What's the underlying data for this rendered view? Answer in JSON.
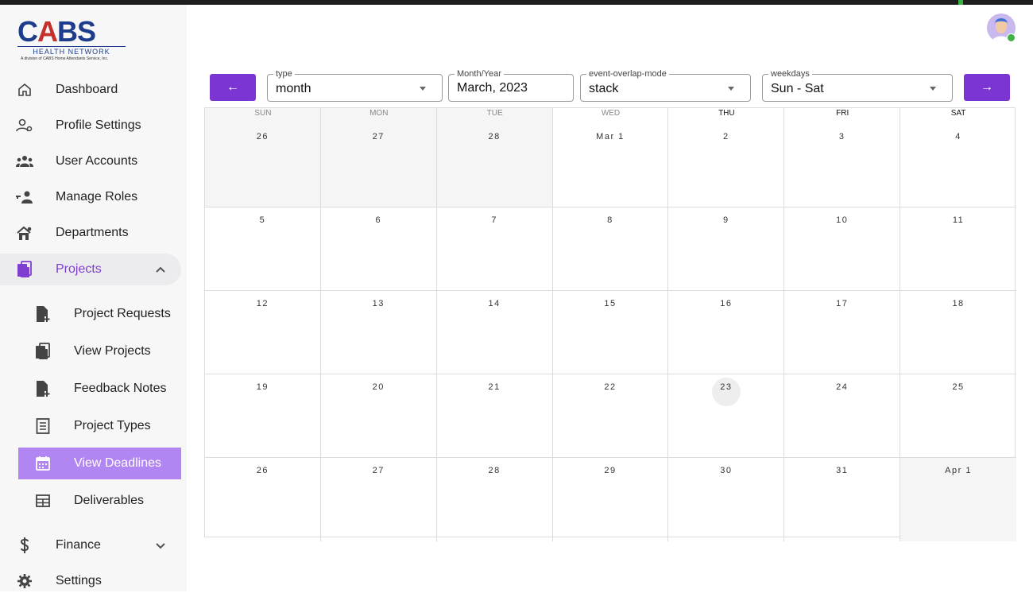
{
  "logo": {
    "wordmark_left": "C",
    "wordmark_a": "A",
    "wordmark_right": "BS",
    "subtitle": "HEALTH NETWORK",
    "tagline": "A division of CABS Home Attendants Service, Inc."
  },
  "sidebar": {
    "items": [
      {
        "label": "Dashboard",
        "icon": "home-icon"
      },
      {
        "label": "Profile Settings",
        "icon": "user-gear-icon"
      },
      {
        "label": "User Accounts",
        "icon": "users-icon"
      },
      {
        "label": "Manage Roles",
        "icon": "user-key-icon"
      },
      {
        "label": "Departments",
        "icon": "departments-icon"
      },
      {
        "label": "Projects",
        "icon": "projects-icon"
      }
    ],
    "project_items": [
      {
        "label": "Project Requests",
        "icon": "file-plus-icon"
      },
      {
        "label": "View Projects",
        "icon": "projects-icon"
      },
      {
        "label": "Feedback Notes",
        "icon": "file-plus-icon"
      },
      {
        "label": "Project Types",
        "icon": "list-doc-icon"
      },
      {
        "label": "View Deadlines",
        "icon": "calendar-icon",
        "active": true
      },
      {
        "label": "Deliverables",
        "icon": "table-icon"
      }
    ],
    "bottom_items": [
      {
        "label": "Finance",
        "icon": "dollar-icon"
      },
      {
        "label": "Settings",
        "icon": "gear-icon"
      }
    ]
  },
  "toolbar": {
    "prev_label": "←",
    "next_label": "→",
    "type": {
      "legend": "type",
      "value": "month"
    },
    "month_year": {
      "legend": "Month/Year",
      "value": "March, 2023"
    },
    "overlap": {
      "legend": "event-overlap-mode",
      "value": "stack"
    },
    "weekdays": {
      "legend": "weekdays",
      "value": "Sun - Sat"
    }
  },
  "calendar": {
    "weekday_headers": [
      "SUN",
      "MON",
      "TUE",
      "WED",
      "THU",
      "FRI",
      "SAT"
    ],
    "weeks": [
      [
        "26",
        "27",
        "28",
        "Mar 1",
        "2",
        "3",
        "4"
      ],
      [
        "5",
        "6",
        "7",
        "8",
        "9",
        "10",
        "11"
      ],
      [
        "12",
        "13",
        "14",
        "15",
        "16",
        "17",
        "18"
      ],
      [
        "19",
        "20",
        "21",
        "22",
        "23",
        "24",
        "25"
      ],
      [
        "26",
        "27",
        "28",
        "29",
        "30",
        "31",
        "Apr 1"
      ]
    ],
    "today": "23",
    "accent_color": "#7b35d3"
  }
}
